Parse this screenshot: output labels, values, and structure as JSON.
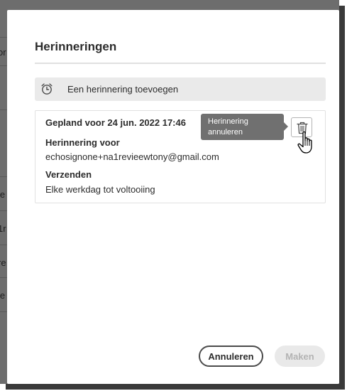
{
  "background": {
    "fragments": [
      "or",
      "ie",
      "1r",
      "re",
      "ie"
    ]
  },
  "dialog": {
    "title": "Herinneringen",
    "add_reminder_label": "Een herinnering toevoegen",
    "reminder": {
      "scheduled": "Gepland voor 24 jun. 2022 17:46",
      "recipient_heading": "Herinnering voor",
      "recipient": "echosignone+na1revieewtony@gmail.com",
      "send_heading": "Verzenden",
      "send_value": "Elke werkdag tot voltooiing"
    },
    "tooltip": {
      "line1": "Herinnering",
      "line2": "annuleren"
    },
    "buttons": {
      "cancel": "Annuleren",
      "create": "Maken"
    }
  },
  "icons": {
    "add": "alarm-clock-icon",
    "delete": "trash-icon",
    "pointer": "hand-pointer-icon"
  },
  "colors": {
    "backdrop": "#6d6d6d",
    "tooltip": "#707070",
    "add_bar": "#eaeaea",
    "disabled_button": "#e9e9e9"
  }
}
